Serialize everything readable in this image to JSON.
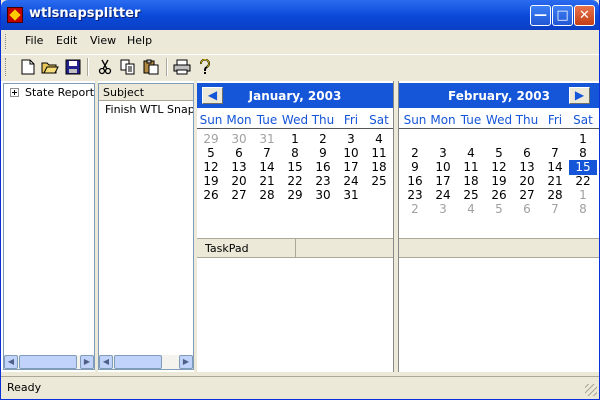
{
  "window": {
    "title": "wtlsnapsplitter",
    "min_glyph": "—",
    "max_glyph": "□",
    "close_glyph": "✕"
  },
  "menu": [
    "File",
    "Edit",
    "View",
    "Help"
  ],
  "toolbar": {
    "icons": [
      "new-file-icon",
      "open-folder-icon",
      "save-icon",
      "cut-icon",
      "copy-icon",
      "paste-icon",
      "print-icon",
      "help-icon"
    ]
  },
  "tree": {
    "root_label": "State Reports"
  },
  "list": {
    "column_header": "Subject",
    "rows": [
      "Finish WTL SnapSplitter"
    ]
  },
  "scroll_glyphs": {
    "left": "◀",
    "right": "▶"
  },
  "calendars": [
    {
      "title": "January, 2003",
      "nav": "prev",
      "nav_glyph": "◀",
      "weekdays": [
        "Sun",
        "Mon",
        "Tue",
        "Wed",
        "Thu",
        "Fri",
        "Sat"
      ],
      "weeks": [
        [
          "29",
          "30",
          "31",
          "1",
          "2",
          "3",
          "4"
        ],
        [
          "5",
          "6",
          "7",
          "8",
          "9",
          "10",
          "11"
        ],
        [
          "12",
          "13",
          "14",
          "15",
          "16",
          "17",
          "18"
        ],
        [
          "19",
          "20",
          "21",
          "22",
          "23",
          "24",
          "25"
        ],
        [
          "26",
          "27",
          "28",
          "29",
          "30",
          "31",
          ""
        ]
      ],
      "other_month": [
        [
          0,
          0
        ],
        [
          0,
          1
        ],
        [
          0,
          2
        ]
      ],
      "today": null
    },
    {
      "title": "February, 2003",
      "nav": "next",
      "nav_glyph": "▶",
      "weekdays": [
        "Sun",
        "Mon",
        "Tue",
        "Wed",
        "Thu",
        "Fri",
        "Sat"
      ],
      "weeks": [
        [
          "",
          "",
          "",
          "",
          "",
          "",
          "1"
        ],
        [
          "2",
          "3",
          "4",
          "5",
          "6",
          "7",
          "8"
        ],
        [
          "9",
          "10",
          "11",
          "12",
          "13",
          "14",
          "15"
        ],
        [
          "16",
          "17",
          "18",
          "19",
          "20",
          "21",
          "22"
        ],
        [
          "23",
          "24",
          "25",
          "26",
          "27",
          "28",
          "1"
        ],
        [
          "2",
          "3",
          "4",
          "5",
          "6",
          "7",
          "8"
        ]
      ],
      "other_month": [
        [
          4,
          6
        ],
        [
          5,
          0
        ],
        [
          5,
          1
        ],
        [
          5,
          2
        ],
        [
          5,
          3
        ],
        [
          5,
          4
        ],
        [
          5,
          5
        ],
        [
          5,
          6
        ]
      ],
      "today": [
        2,
        6
      ]
    }
  ],
  "taskpad": {
    "header": "TaskPad"
  },
  "status": {
    "text": "Ready"
  },
  "colors": {
    "accent": "#1555d8",
    "title_bar": "#0a49d8",
    "chrome": "#ece9d8"
  }
}
